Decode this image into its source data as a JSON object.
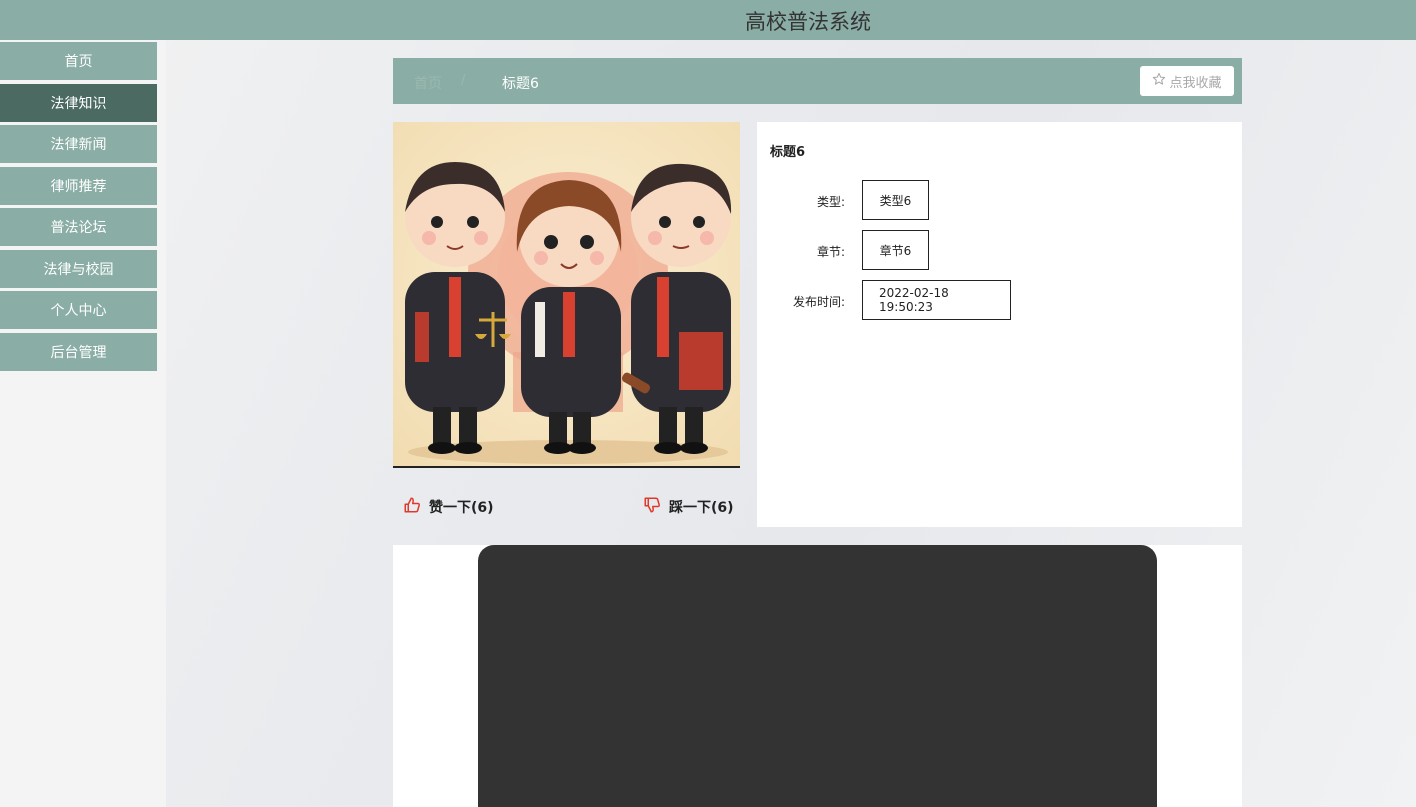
{
  "header": {
    "title": "高校普法系统"
  },
  "sidebar": {
    "items": [
      {
        "label": "首页"
      },
      {
        "label": "法律知识"
      },
      {
        "label": "法律新闻"
      },
      {
        "label": "律师推荐"
      },
      {
        "label": "普法论坛"
      },
      {
        "label": "法律与校园"
      },
      {
        "label": "个人中心"
      },
      {
        "label": "后台管理"
      }
    ],
    "active_index": 1
  },
  "breadcrumb": {
    "home": "首页",
    "separator": "/",
    "current": "标题6"
  },
  "favorite_button": {
    "icon": "star-outline-icon",
    "label": "点我收藏"
  },
  "votes": {
    "like": {
      "icon": "thumbs-up-icon",
      "label": "赞一下(6)"
    },
    "dislike": {
      "icon": "thumbs-down-icon",
      "label": "踩一下(6)"
    }
  },
  "detail": {
    "title": "标题6",
    "fields": [
      {
        "label": "类型:",
        "value": "类型6"
      },
      {
        "label": "章节:",
        "value": "章节6"
      },
      {
        "label": "发布时间:",
        "value": "2022-02-18 19:50:23"
      }
    ]
  },
  "colors": {
    "header": "#8aaea5",
    "nav_active": "#4a6a62",
    "accent_red": "#e0392b"
  }
}
